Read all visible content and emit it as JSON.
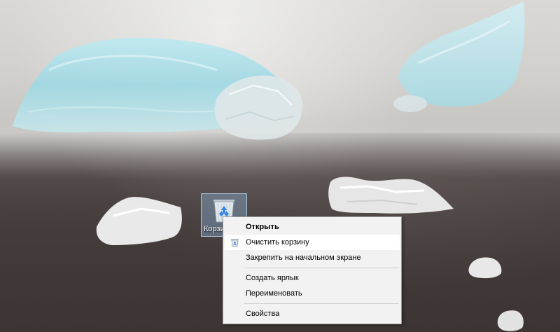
{
  "desktop": {
    "recycle_bin": {
      "label": "Корзина",
      "icon": "recycle-bin-icon"
    }
  },
  "context_menu": {
    "items": [
      {
        "label": "Открыть",
        "bold": true
      },
      {
        "label": "Очистить корзину",
        "icon": "recycle-bin-small-icon",
        "highlighted": true
      },
      {
        "label": "Закрепить на начальном экране"
      },
      {
        "label": "Создать ярлык"
      },
      {
        "label": "Переименовать"
      },
      {
        "label": "Свойства"
      }
    ]
  },
  "colors": {
    "menu_background": "#f2f2f2",
    "menu_highlight": "#ffffff",
    "selection_blue": "#99ccff"
  }
}
